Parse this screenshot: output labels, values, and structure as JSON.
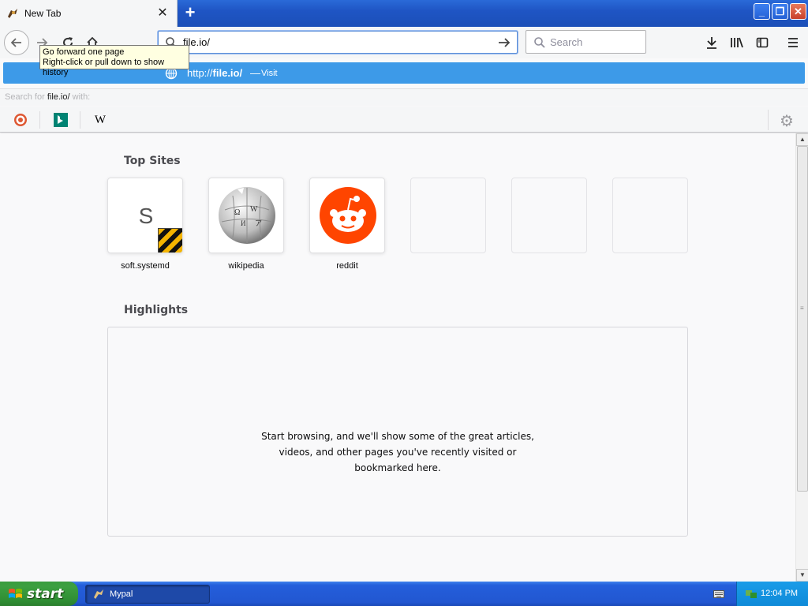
{
  "browser": {
    "tab": {
      "title": "New Tab"
    },
    "toolbar": {
      "url_value": "file.io/",
      "search_placeholder": "Search"
    },
    "tooltip": {
      "line1": "Go forward one page",
      "line2": "Right-click or pull down to show history"
    },
    "suggestion": {
      "url_prefix": "http://",
      "url_bold": "file.io/",
      "separator": "—",
      "action": "Visit"
    },
    "search_for": {
      "prefix": "Search for ",
      "query": "file.io/",
      "suffix": " with:"
    },
    "engines": [
      {
        "name": "duckduckgo",
        "icon": "duckduckgo-icon"
      },
      {
        "name": "bing",
        "icon": "bing-icon"
      },
      {
        "name": "wikipedia",
        "icon": "wikipedia-w-icon",
        "glyph": "W"
      }
    ]
  },
  "newtab": {
    "top_sites_title": "Top Sites",
    "top_sites": [
      {
        "label": "soft.systemd",
        "letter": "S"
      },
      {
        "label": "wikipedia"
      },
      {
        "label": "reddit"
      },
      {
        "label": ""
      },
      {
        "label": ""
      },
      {
        "label": ""
      }
    ],
    "highlights_title": "Highlights",
    "highlights_message_lines": [
      "Start browsing, and we'll show some of the great articles,",
      "videos, and other pages you've recently visited or",
      "bookmarked here."
    ]
  },
  "taskbar": {
    "start_label": "start",
    "task_label": "Mypal",
    "clock": "12:04 PM"
  },
  "colors": {
    "suggest_bg": "#3d9ae8",
    "reddit": "#ff4500",
    "taskbar": "#245edb",
    "start": "#3c9f40"
  }
}
